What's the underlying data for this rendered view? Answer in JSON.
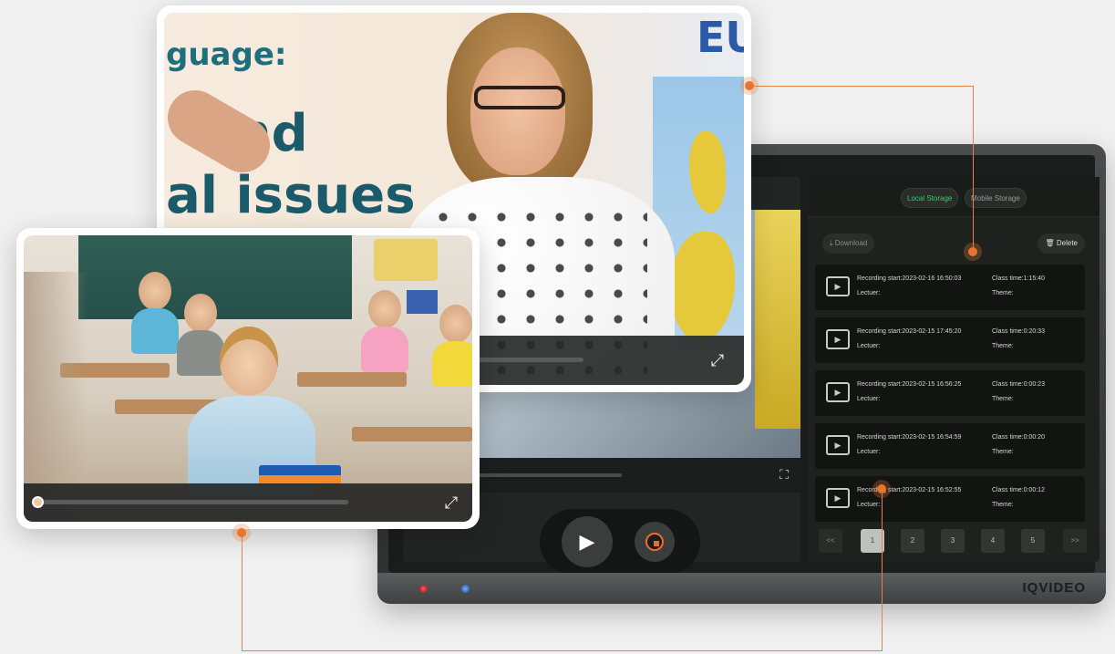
{
  "colors": {
    "accent": "#e8752e",
    "local_storage_active": "#2bd36a",
    "panel_bg": "#1f211f"
  },
  "top_video": {
    "wall_text": [
      "guage:",
      "and",
      "al issues",
      "EU"
    ],
    "fullscreen_icon": "expand-icon"
  },
  "left_video": {
    "fullscreen_icon": "expand-icon"
  },
  "monitor": {
    "brand": "IQVIDEO",
    "inner_player": {
      "fullscreen_icon": "expand-icon",
      "controls": {
        "play_icon": "▶",
        "stop_icon": "stop-record-icon"
      }
    },
    "panel": {
      "tabs": [
        "Local Storage",
        "Mobile Storage"
      ],
      "active_tab": "Local Storage",
      "download_label": "⤓ Download",
      "delete_label": "🗑 Delete",
      "recordings": [
        {
          "start": "Recording start:2023-02-16 16:50:03",
          "class_time": "Class time:1:15:40",
          "lecturer": "Lectuer:",
          "theme": "Theme:"
        },
        {
          "start": "Recording start:2023-02-15 17:45:20",
          "class_time": "Class time:0:20:33",
          "lecturer": "Lectuer:",
          "theme": "Theme:"
        },
        {
          "start": "Recording start:2023-02-15 16:56:25",
          "class_time": "Class time:0:00:23",
          "lecturer": "Lectuer:",
          "theme": "Theme:"
        },
        {
          "start": "Recording start:2023-02-15 16:54:59",
          "class_time": "Class time:0:00:20",
          "lecturer": "Lectuer:",
          "theme": "Theme:"
        },
        {
          "start": "Recording start:2023-02-15 16:52:55",
          "class_time": "Class time:0:00:12",
          "lecturer": "Lectuer:",
          "theme": "Theme:"
        }
      ],
      "pagination": {
        "prev": "<<",
        "pages": [
          "1",
          "2",
          "3",
          "4",
          "5"
        ],
        "current": "1",
        "next": ">>"
      }
    }
  }
}
